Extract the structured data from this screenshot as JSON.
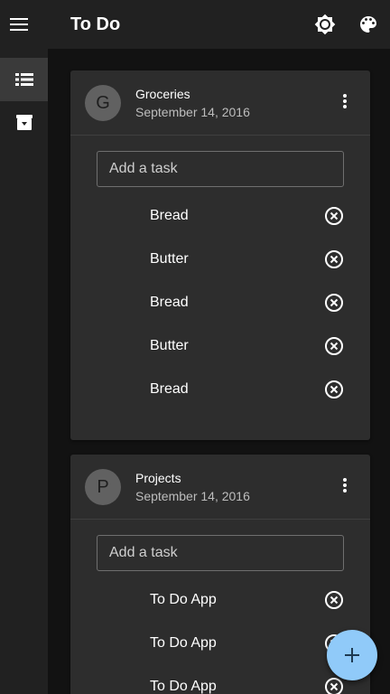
{
  "app": {
    "title": "To Do"
  },
  "sidebar": {
    "items": [
      {
        "icon": "list-icon",
        "active": true
      },
      {
        "icon": "archive-icon",
        "active": false
      }
    ]
  },
  "lists": [
    {
      "avatar": "G",
      "name": "Groceries",
      "date": "September 14, 2016",
      "input_placeholder": "Add a task",
      "tasks": [
        "Bread",
        "Butter",
        "Bread",
        "Butter",
        "Bread"
      ]
    },
    {
      "avatar": "P",
      "name": "Projects",
      "date": "September 14, 2016",
      "input_placeholder": "Add a task",
      "tasks": [
        "To Do App",
        "To Do App",
        "To Do App"
      ]
    }
  ],
  "colors": {
    "appbar": "#212121",
    "background": "#121212",
    "card": "#2d2d2d",
    "fab": "#90caf9"
  }
}
